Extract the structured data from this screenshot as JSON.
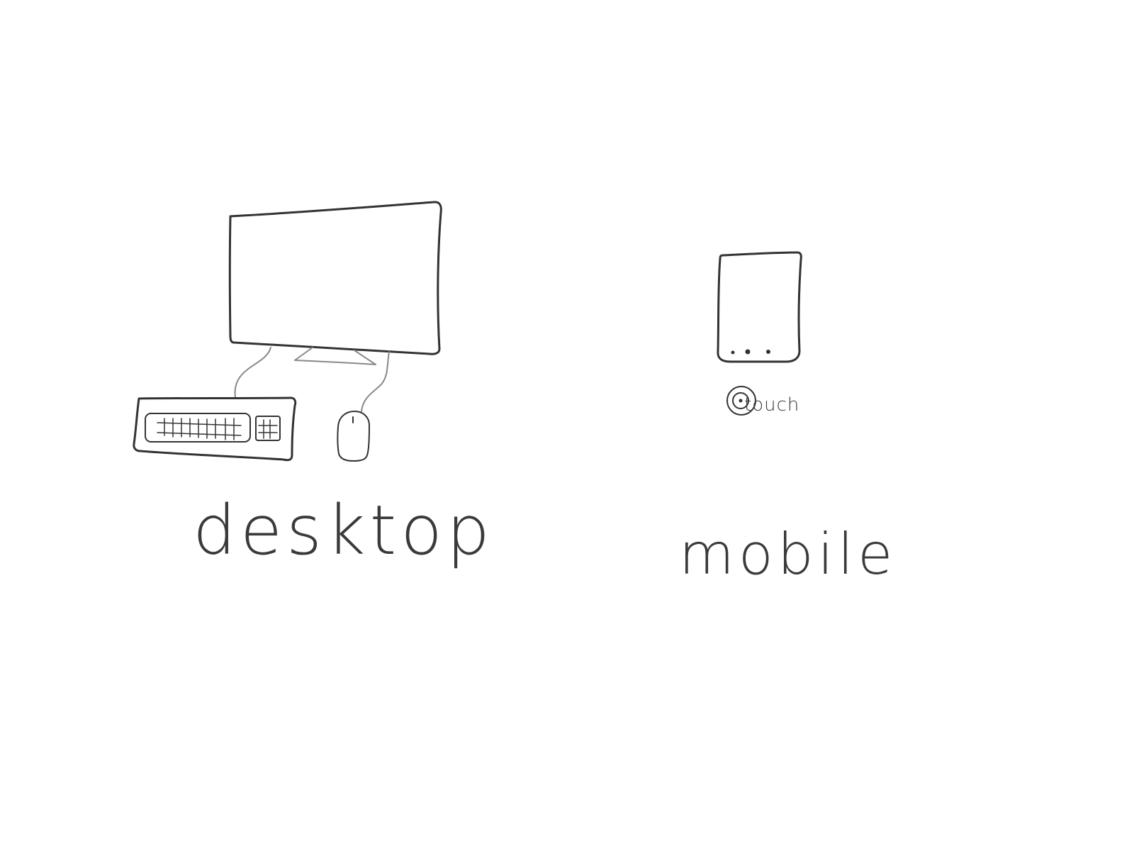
{
  "colors": {
    "background": "#ffffff",
    "ink": "#333333",
    "ink_light": "#888888",
    "caption": "#3a3a3a"
  },
  "desktop": {
    "caption": "desktop",
    "icons": [
      "monitor-icon",
      "keyboard-icon",
      "mouse-icon"
    ]
  },
  "mobile": {
    "caption": "mobile",
    "icons": [
      "phone-icon"
    ]
  },
  "touch": {
    "label": "touch",
    "icon": "touch-target-icon"
  }
}
